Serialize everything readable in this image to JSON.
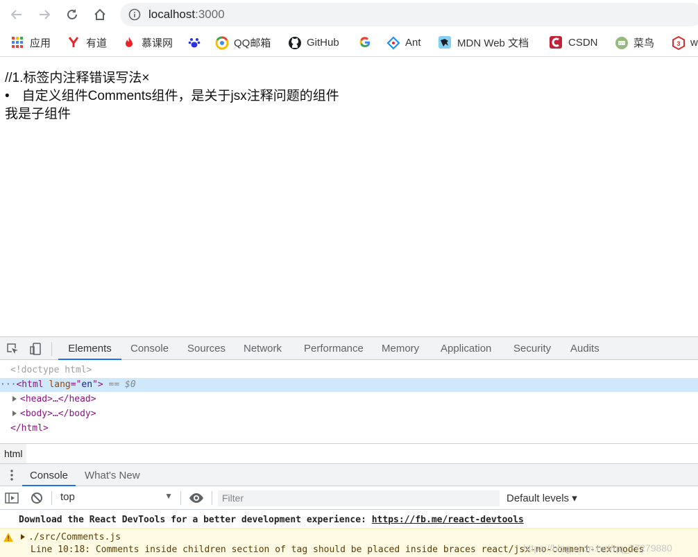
{
  "browser": {
    "url_host": "localhost",
    "url_port": ":3000"
  },
  "bookmarks": [
    {
      "label": "应用",
      "icon": "apps-grid-icon"
    },
    {
      "label": "有道",
      "icon": "youdao-icon"
    },
    {
      "label": "慕课网",
      "icon": "imooc-flame-icon"
    },
    {
      "label": "",
      "icon": "baidu-paw-icon"
    },
    {
      "label": "QQ邮箱",
      "icon": "qqmail-icon"
    },
    {
      "label": "GitHub",
      "icon": "github-icon"
    },
    {
      "label": "",
      "icon": "google-icon"
    },
    {
      "label": "Ant",
      "icon": "ant-design-icon"
    },
    {
      "label": "MDN Web 文档",
      "icon": "mdn-icon"
    },
    {
      "label": "CSDN",
      "icon": "csdn-icon"
    },
    {
      "label": "菜鸟",
      "icon": "runoob-icon"
    },
    {
      "label": "w",
      "icon": "w3cschool-icon"
    }
  ],
  "page": {
    "line1": "//1.标签内注释错误写法×",
    "bullet": "•",
    "line2": "自定义组件Comments组件，是关于jsx注释问题的组件",
    "line3": "我是子组件"
  },
  "devtools": {
    "tabs": [
      "Elements",
      "Console",
      "Sources",
      "Network",
      "Performance",
      "Memory",
      "Application",
      "Security",
      "Audits"
    ],
    "elements": {
      "doctype": "<!doctype html>",
      "html_open_tag": "<html",
      "html_attr_name": " lang",
      "html_attr_eq": "=\"",
      "html_attr_val": "en",
      "html_attr_close": "\">",
      "selected_marker": " == $0",
      "head": "<head>…</head>",
      "body": "<body>…</body>",
      "html_close": "</html>"
    },
    "breadcrumb": "html",
    "drawer_tabs": [
      "Console",
      "What's New"
    ],
    "context": "top",
    "filter_placeholder": "Filter",
    "levels": "Default levels ▾",
    "messages": {
      "info_text": "Download the React DevTools for a better development experience: ",
      "info_link": "https://fb.me/react-devtools",
      "warn_file": "./src/Comments.js",
      "warn_line": "Line 10:18:  Comments inside children section of tag should be placed inside braces  react/jsx-no-comment-textnodes",
      "watermark": "https://blog.csdn.net/qq_37279880"
    }
  }
}
